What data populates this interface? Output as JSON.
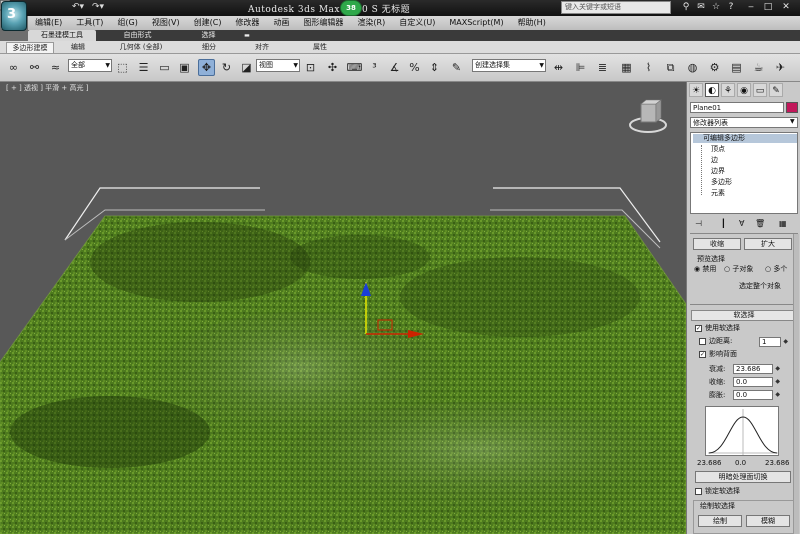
{
  "title_bar": {
    "title": "Autodesk 3ds Max  2010  S    无标题",
    "badge": "38",
    "search_placeholder": "键入关键字或短语"
  },
  "menu": [
    "编辑(E)",
    "工具(T)",
    "组(G)",
    "视图(V)",
    "创建(C)",
    "修改器",
    "动画",
    "图形编辑器",
    "渲染(R)",
    "自定义(U)",
    "MAXScript(M)",
    "帮助(H)"
  ],
  "ribbon_tabs": [
    "石墨建模工具",
    "自由形式",
    "选择"
  ],
  "ribbon_subtabs": [
    "多边形建模",
    "编辑",
    "几何体 (全部)",
    "细分",
    "对齐",
    "属性"
  ],
  "toolbar": {
    "filter_value": "全部",
    "coord_value": "视图",
    "selset_value": "创建选择集"
  },
  "viewport": {
    "label": "[ + ] 透视 ] 平滑 + 高光 ]"
  },
  "command_panel": {
    "object_name": "Plane01",
    "object_color": "#c2185b",
    "modifier_list": "修改器列表",
    "stack_root": "可编辑多边形",
    "stack_items": [
      "顶点",
      "边",
      "边界",
      "多边形",
      "元素"
    ],
    "stack_buttons": [
      "pin-icon",
      "show-end-icon",
      "unique-icon",
      "remove-icon",
      "config-icon"
    ],
    "top_buttons": [
      "收缩",
      "扩大"
    ],
    "preview_title": "预览选择",
    "preview_options": [
      "禁用",
      "子对象",
      "多个"
    ],
    "select_all_label": "选定整个对象",
    "soft_selection": {
      "header": "软选择",
      "use_soft": "使用软选择",
      "edge_distance": "边距离:",
      "edge_distance_value": "1",
      "affect_backface": "影响背面",
      "falloff_label": "衰减:",
      "falloff_value": "23.686",
      "pinch_label": "收缩:",
      "pinch_value": "0.0",
      "bubble_label": "膨胀:",
      "bubble_value": "0.0",
      "curve_left": "23.686",
      "curve_mid": "0.0",
      "curve_right": "23.686",
      "shaded_face_toggle": "明暗处理面切换",
      "lock_soft": "锁定软选择",
      "paint_header": "绘制软选择",
      "paint_button": "绘制",
      "blur_button": "模糊"
    }
  }
}
